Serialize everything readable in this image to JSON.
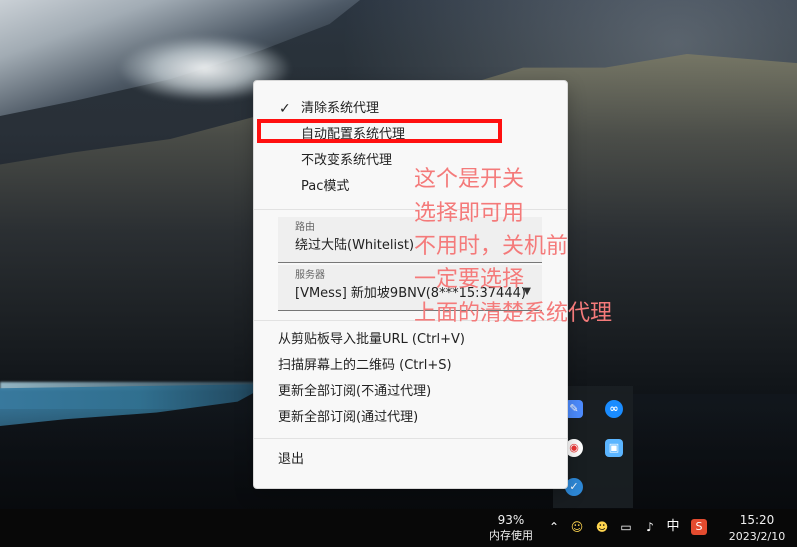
{
  "menu": {
    "proxy_modes": [
      {
        "label": "清除系统代理",
        "checked": true
      },
      {
        "label": "自动配置系统代理",
        "checked": false
      },
      {
        "label": "不改变系统代理",
        "checked": false
      },
      {
        "label": "Pac模式",
        "checked": false
      }
    ],
    "route": {
      "label": "路由",
      "value": "绕过大陆(Whitelist)"
    },
    "server": {
      "label": "服务器",
      "value": "[VMess] 新加坡9BNV(8***15:37444)"
    },
    "actions": [
      "从剪贴板导入批量URL (Ctrl+V)",
      "扫描屏幕上的二维码 (Ctrl+S)",
      "更新全部订阅(不通过代理)",
      "更新全部订阅(通过代理)"
    ],
    "exit": "退出"
  },
  "annotation": {
    "lines": [
      "这个是开关",
      "选择即可用",
      "不用时，关机前",
      "一定要选择",
      "上面的清楚系统代理"
    ],
    "color": "#f47a7a"
  },
  "taskbar": {
    "memory_percent": "93%",
    "memory_label": "内存使用",
    "ime": "中",
    "time": "15:20",
    "date": "2023/2/10"
  },
  "icons": {
    "tray_arrow": "chevron-up-icon",
    "qq": "qq-icon",
    "network": "network-icon",
    "volume": "volume-muted-icon",
    "sogou": "sogou-input-icon",
    "notification": "notification-icon"
  }
}
